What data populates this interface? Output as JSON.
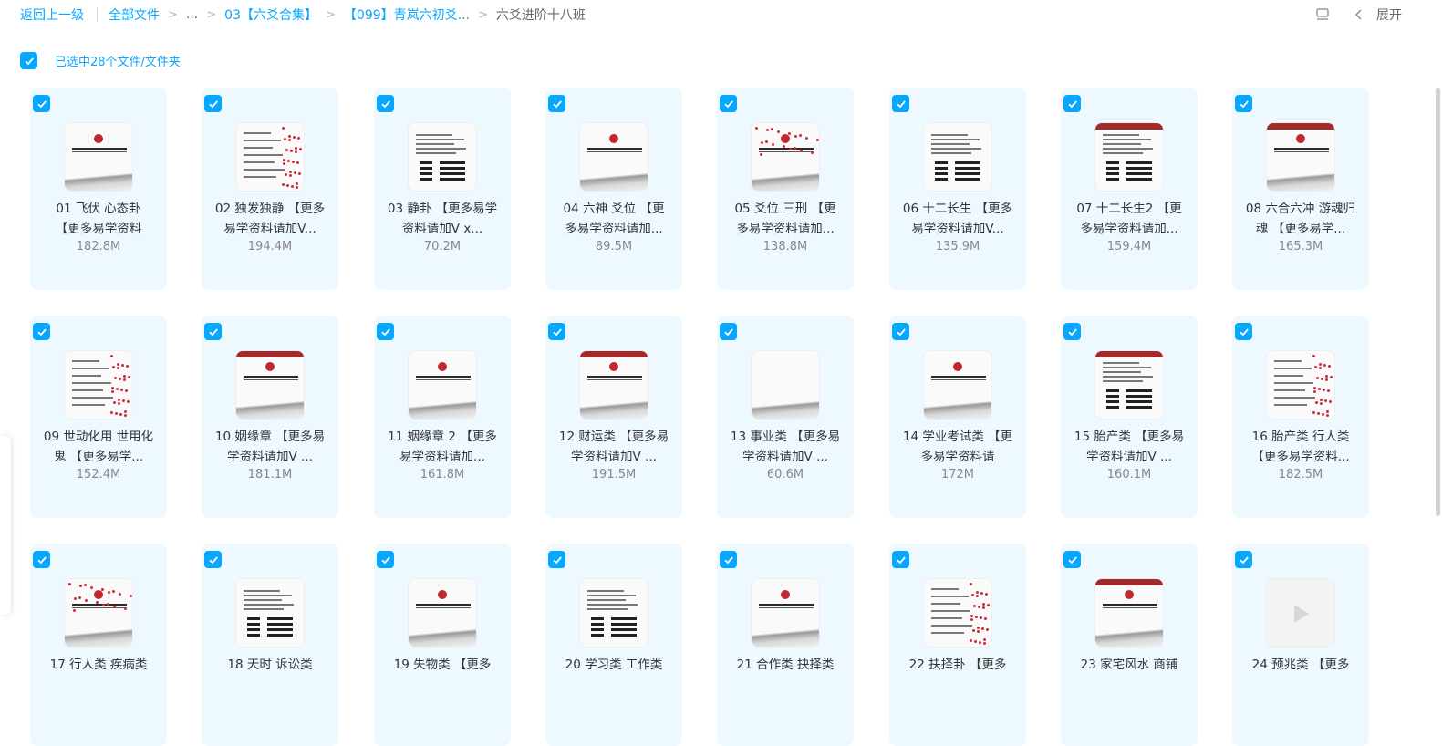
{
  "breadcrumb": {
    "back": "返回上一级",
    "all_files": "全部文件",
    "ellipsis": "...",
    "level1": "03【六爻合集】",
    "level2": "【099】青岚六初爻...",
    "current": "六爻进阶十八班"
  },
  "top_right": {
    "view_icon": "list-view-icon",
    "collapse_icon": "chevron-left-icon",
    "expand_label": "展开"
  },
  "selection": {
    "checked": true,
    "label": "已选中28个文件/文件夹"
  },
  "colors": {
    "accent": "#06a7ff",
    "card_bg": "#eef8ff",
    "seal_red": "#c2262e"
  },
  "files": [
    {
      "name": "01 飞伏 心态卦 【更多易学资料",
      "size": "182.8M",
      "thumb": "ink",
      "checked": true
    },
    {
      "name": "02 独发独静 【更多易学资料请加V...",
      "size": "194.4M",
      "thumb": "scan",
      "checked": true
    },
    {
      "name": "03 静卦 【更多易学资料请加V x...",
      "size": "70.2M",
      "thumb": "doc",
      "checked": true
    },
    {
      "name": "04 六神 爻位 【更多易学资料请加...",
      "size": "89.5M",
      "thumb": "ink",
      "checked": true
    },
    {
      "name": "05 爻位 三刑 【更多易学资料请加...",
      "size": "138.8M",
      "thumb": "ink-scan",
      "checked": true
    },
    {
      "name": "06 十二长生 【更多易学资料请加V...",
      "size": "135.9M",
      "thumb": "doc",
      "checked": true
    },
    {
      "name": "07 十二长生2 【更多易学资料请加...",
      "size": "159.4M",
      "thumb": "doc-red",
      "checked": true
    },
    {
      "name": "08 六合六冲 游魂归魂 【更多易学...",
      "size": "165.3M",
      "thumb": "ink-red",
      "checked": true
    },
    {
      "name": "09 世动化用 世用化鬼 【更多易学...",
      "size": "152.4M",
      "thumb": "scan",
      "checked": true
    },
    {
      "name": "10 姻缘章 【更多易学资料请加V ...",
      "size": "181.1M",
      "thumb": "ink-red",
      "checked": true
    },
    {
      "name": "11 姻缘章 2 【更多易学资料请加...",
      "size": "161.8M",
      "thumb": "ink",
      "checked": true
    },
    {
      "name": "12 财运类 【更多易学资料请加V ...",
      "size": "191.5M",
      "thumb": "ink-red",
      "checked": true
    },
    {
      "name": "13 事业类 【更多易学资料请加V ...",
      "size": "60.6M",
      "thumb": "ink-plain",
      "checked": true
    },
    {
      "name": "14 学业考试类 【更多易学资料请",
      "size": "172M",
      "thumb": "ink",
      "checked": true
    },
    {
      "name": "15 胎产类 【更多易学资料请加V ...",
      "size": "160.1M",
      "thumb": "doc-red",
      "checked": true
    },
    {
      "name": "16 胎产类 行人类 【更多易学资料...",
      "size": "182.5M",
      "thumb": "scan",
      "checked": true
    },
    {
      "name": "17 行人类 疾病类",
      "size": "",
      "thumb": "ink-scan",
      "checked": true
    },
    {
      "name": "18 天时 诉讼类",
      "size": "",
      "thumb": "doc",
      "checked": true
    },
    {
      "name": "19 失物类 【更多",
      "size": "",
      "thumb": "ink",
      "checked": true
    },
    {
      "name": "20 学习类 工作类",
      "size": "",
      "thumb": "doc",
      "checked": true
    },
    {
      "name": "21 合作类 抉择类",
      "size": "",
      "thumb": "ink",
      "checked": true
    },
    {
      "name": "22 抉择卦 【更多",
      "size": "",
      "thumb": "scan",
      "checked": true
    },
    {
      "name": "23 家宅风水 商铺",
      "size": "",
      "thumb": "ink-red",
      "checked": true
    },
    {
      "name": "24 预兆类 【更多",
      "size": "",
      "thumb": "video",
      "checked": true
    }
  ]
}
